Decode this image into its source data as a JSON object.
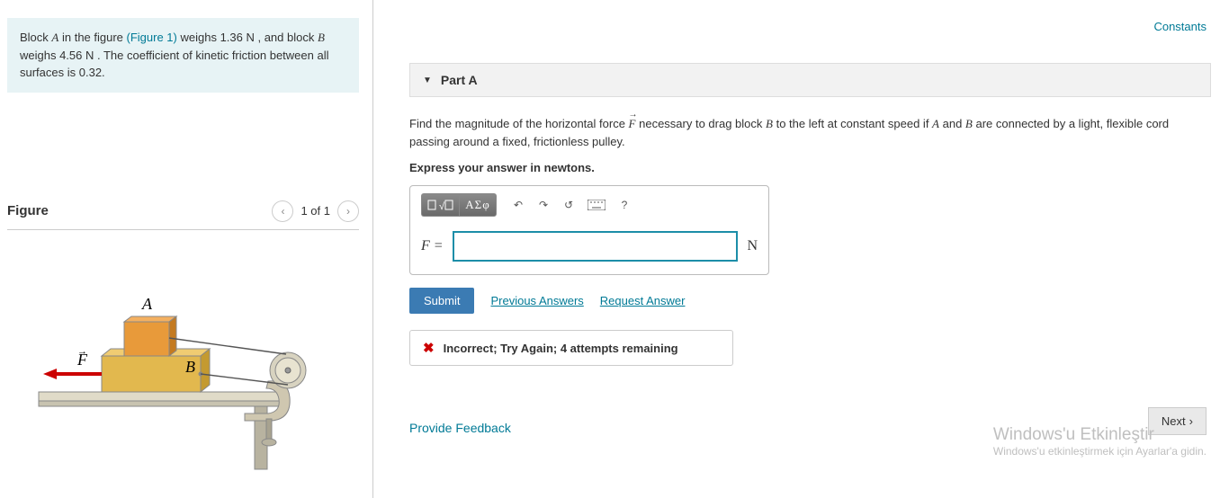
{
  "constants_link": "Constants",
  "problem": {
    "text_prefix": "Block ",
    "A": "A",
    "after_A": " in the figure ",
    "fig_link": "(Figure 1)",
    "after_fig": " weighs 1.36 N , and block ",
    "B": "B",
    "after_B": " weighs 4.56 N . The coefficient of kinetic friction between all surfaces is 0.32."
  },
  "figure": {
    "title": "Figure",
    "pager": "1 of 1",
    "labels": {
      "A": "A",
      "B": "B",
      "F": "F"
    }
  },
  "part": {
    "label": "Part A",
    "question_prefix": "Find the magnitude of the horizontal force ",
    "F": "F",
    "question_mid": " necessary to drag block ",
    "B": "B",
    "question_mid2": " to the left at constant speed if ",
    "A": "A",
    "and": " and ",
    "B2": "B",
    "question_suffix": " are connected by a light, flexible cord passing around a fixed, frictionless pulley.",
    "instruction": "Express your answer in newtons.",
    "toolbar": {
      "templates_icon": "templates-icon",
      "greek": "ΑΣφ"
    },
    "lhs": "F =",
    "answer_value": "",
    "unit": "N",
    "submit": "Submit",
    "prev": "Previous Answers",
    "req": "Request Answer",
    "fb_msg": "Incorrect; Try Again; 4 attempts remaining"
  },
  "provide_feedback": "Provide Feedback",
  "next": "Next",
  "watermark": {
    "l1": "Windows'u Etkinleştir",
    "l2": "Windows'u etkinleştirmek için Ayarlar'a gidin."
  }
}
